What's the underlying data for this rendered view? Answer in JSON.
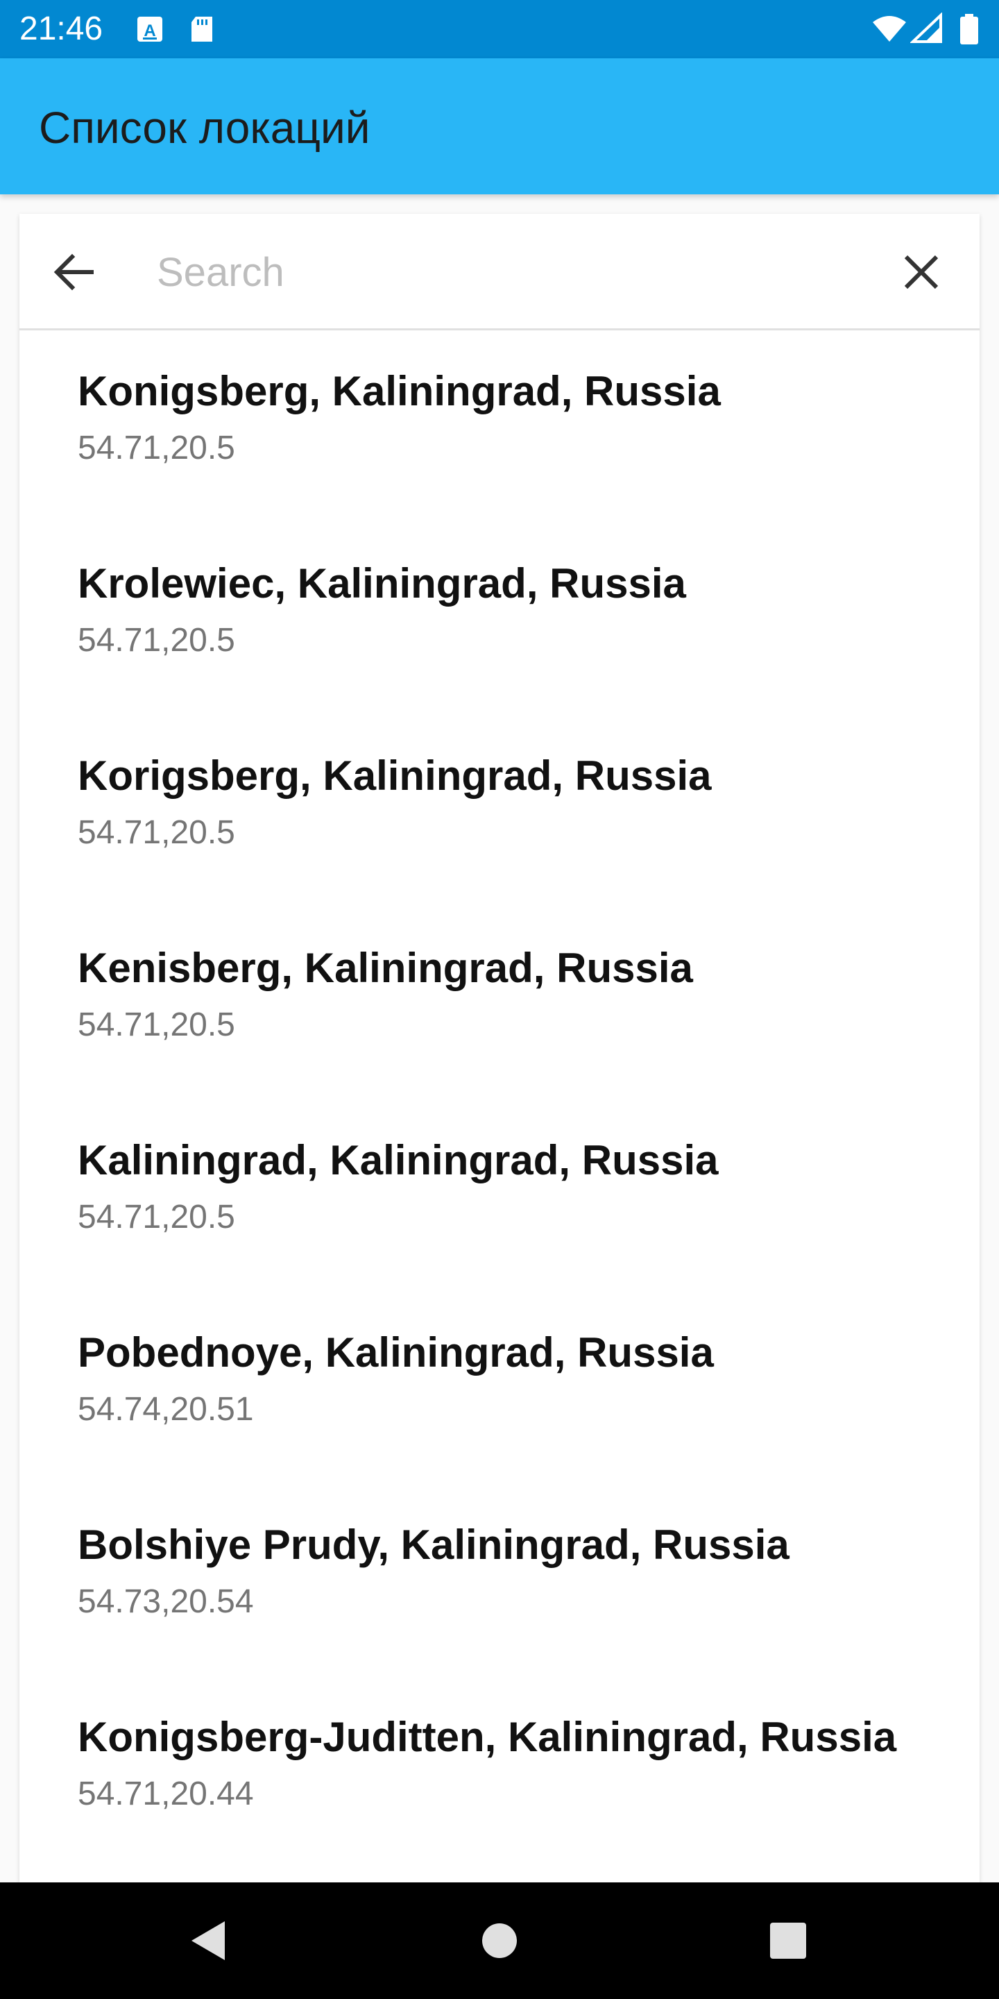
{
  "status_bar": {
    "time": "21:46",
    "icons": [
      "keyboard-a-icon",
      "sd-card-icon",
      "wifi-icon",
      "signal-icon",
      "battery-icon"
    ],
    "background_color": "#0288d1"
  },
  "app_bar": {
    "title": "Список локаций",
    "background_color": "#29b6f6"
  },
  "search": {
    "placeholder": "Search",
    "value": "",
    "back_icon": "arrow-back-icon",
    "clear_icon": "close-icon"
  },
  "locations": [
    {
      "name": "Konigsberg, Kaliningrad, Russia",
      "coords": "54.71,20.5"
    },
    {
      "name": "Krolewiec, Kaliningrad, Russia",
      "coords": "54.71,20.5"
    },
    {
      "name": "Korigsberg, Kaliningrad, Russia",
      "coords": "54.71,20.5"
    },
    {
      "name": "Kenisberg, Kaliningrad, Russia",
      "coords": "54.71,20.5"
    },
    {
      "name": "Kaliningrad, Kaliningrad, Russia",
      "coords": "54.71,20.5"
    },
    {
      "name": "Pobednoye, Kaliningrad, Russia",
      "coords": "54.74,20.51"
    },
    {
      "name": "Bolshiye Prudy, Kaliningrad, Russia",
      "coords": "54.73,20.54"
    },
    {
      "name": "Konigsberg-Juditten, Kaliningrad, Russia",
      "coords": "54.71,20.44"
    }
  ],
  "nav_bar": {
    "icons": [
      "back-triangle-icon",
      "home-circle-icon",
      "recents-square-icon"
    ]
  }
}
